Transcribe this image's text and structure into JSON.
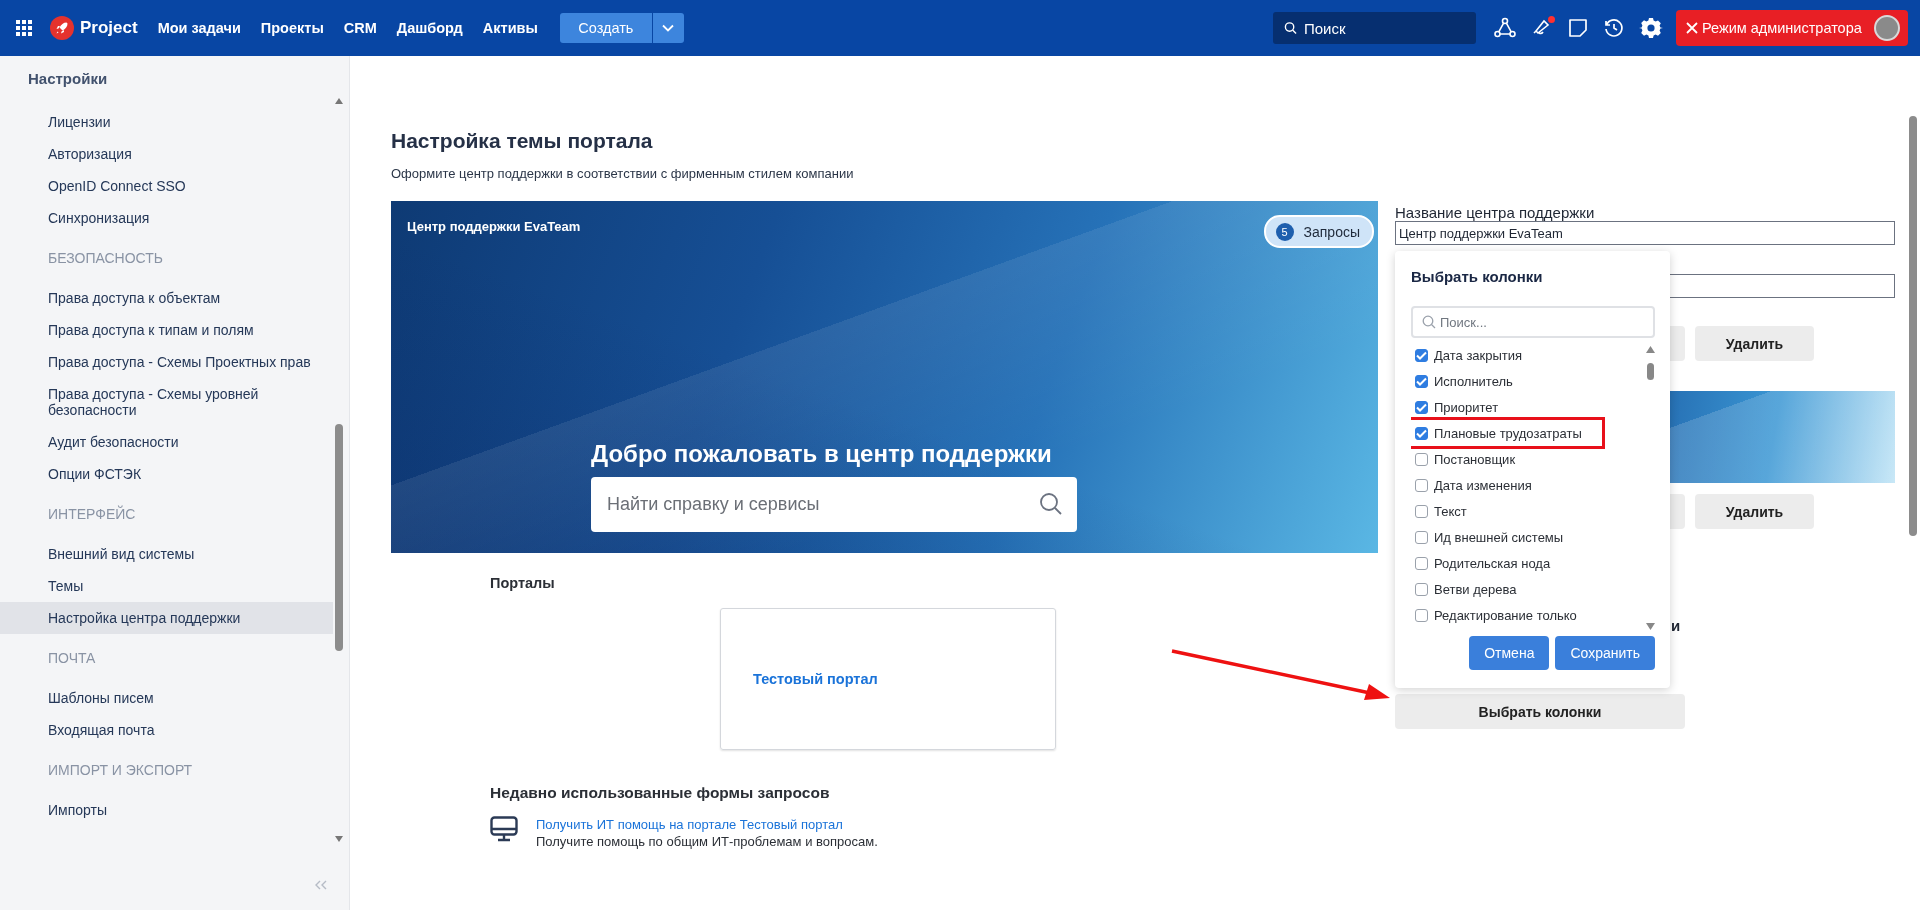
{
  "topbar": {
    "logo": "Project",
    "nav": [
      "Мои задачи",
      "Проекты",
      "CRM",
      "Дашборд",
      "Активы"
    ],
    "create_button": "Создать",
    "search": {
      "placeholder": "Поиск"
    },
    "notification_unread": true,
    "admin_button": "Режим администратора"
  },
  "sidebar": {
    "title": "Настройки",
    "sections": [
      {
        "items": [
          {
            "label": "Лицензии",
            "selected": false
          },
          {
            "label": "Авторизация",
            "selected": false
          },
          {
            "label": "OpenID Connect SSO",
            "selected": false
          },
          {
            "label": "Синхронизация",
            "selected": false
          }
        ]
      },
      {
        "heading": "БЕЗОПАСНОСТЬ",
        "items": [
          {
            "label": "Права доступа к объектам",
            "selected": false
          },
          {
            "label": "Права доступа к типам и полям",
            "selected": false
          },
          {
            "label": "Права доступа - Схемы Проектных прав",
            "selected": false
          },
          {
            "label": "Права доступа - Схемы уровней безопасности",
            "selected": false
          },
          {
            "label": "Аудит безопасности",
            "selected": false
          },
          {
            "label": "Опции ФСТЭК",
            "selected": false
          }
        ]
      },
      {
        "heading": "ИНТЕРФЕЙС",
        "items": [
          {
            "label": "Внешний вид системы",
            "selected": false
          },
          {
            "label": "Темы",
            "selected": false
          },
          {
            "label": "Настройка центра поддержки",
            "selected": true
          }
        ]
      },
      {
        "heading": "ПОЧТА",
        "items": [
          {
            "label": "Шаблоны писем",
            "selected": false
          },
          {
            "label": "Входящая почта",
            "selected": false
          }
        ]
      },
      {
        "heading": "ИМПОРТ И ЭКСПОРТ",
        "items": [
          {
            "label": "Импорты",
            "selected": false
          }
        ]
      }
    ]
  },
  "page": {
    "title": "Настройка темы портала",
    "subtitle": "Оформите центр поддержки в соответствии с фирменным стилем компании"
  },
  "banner": {
    "title": "Центр поддержки EvaTeam",
    "requests": {
      "count": "5",
      "label": "Запросы"
    },
    "welcome": "Добро пожаловать в центр поддержки",
    "search": {
      "placeholder": "Найти справку и сервисы"
    }
  },
  "portals": {
    "heading": "Порталы",
    "items": [
      {
        "name": "Тестовый портал"
      }
    ]
  },
  "recent_forms": {
    "heading": "Недавно использованные формы запросов",
    "items": [
      {
        "title": "Получить ИТ помощь на портале Тестовый портал",
        "description": "Получите помощь по общим ИТ-проблемам и вопросам."
      }
    ]
  },
  "settings_panel": {
    "name_label": "Название центра поддержки",
    "name_value": "Центр поддержки EvaTeam",
    "delete_buttons": [
      "Удалить",
      "Удалить"
    ],
    "partial_label": "и",
    "columns_button": "Выбрать колонки"
  },
  "column_picker": {
    "title": "Выбрать колонки",
    "search": {
      "placeholder": "Поиск..."
    },
    "items": [
      {
        "label": "Дата закрытия",
        "checked": true,
        "highlighted": false
      },
      {
        "label": "Исполнитель",
        "checked": true,
        "highlighted": false
      },
      {
        "label": "Приоритет",
        "checked": true,
        "highlighted": false
      },
      {
        "label": "Плановые трудозатраты",
        "checked": true,
        "highlighted": true
      },
      {
        "label": "Постановщик",
        "checked": false,
        "highlighted": false
      },
      {
        "label": "Дата изменения",
        "checked": false,
        "highlighted": false
      },
      {
        "label": "Текст",
        "checked": false,
        "highlighted": false
      },
      {
        "label": "Ид внешней системы",
        "checked": false,
        "highlighted": false
      },
      {
        "label": "Родительская нода",
        "checked": false,
        "highlighted": false
      },
      {
        "label": "Ветви дерева",
        "checked": false,
        "highlighted": false
      },
      {
        "label": "Редактирование только",
        "checked": false,
        "highlighted": false
      }
    ],
    "buttons": [
      "Отмена",
      "Сохранить"
    ]
  },
  "annotations": [
    {
      "kind": "arrow"
    }
  ]
}
